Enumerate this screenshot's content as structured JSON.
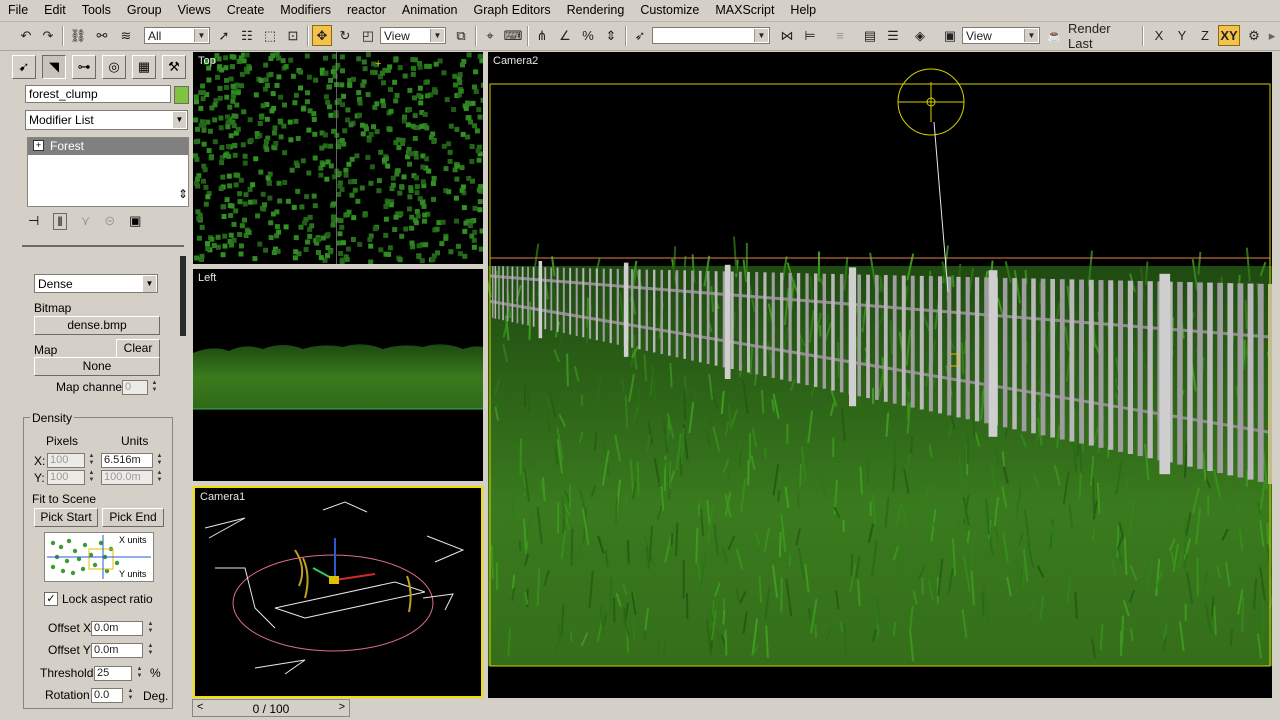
{
  "menu": [
    "File",
    "Edit",
    "Tools",
    "Group",
    "Views",
    "Create",
    "Modifiers",
    "reactor",
    "Animation",
    "Graph Editors",
    "Rendering",
    "Customize",
    "MAXScript",
    "Help"
  ],
  "toolbar": {
    "selection_filter": "All",
    "ref_coord_1": "View",
    "ref_coord_2": "View",
    "named_selection": "",
    "render_last_label": "Render Last",
    "axis_x": "X",
    "axis_y": "Y",
    "axis_z": "Z",
    "axis_xy": "XY"
  },
  "command_panel": {
    "object_name": "forest_clump",
    "object_color": "#7ec440",
    "modifier_list": "Modifier List",
    "stack_item": "Forest",
    "distribution_mode": "Dense",
    "bitmap_label": "Bitmap",
    "bitmap_button": "dense.bmp",
    "map_label": "Map",
    "clear_button": "Clear",
    "map_button": "None",
    "map_channel_label": "Map channel",
    "map_channel_value": "0",
    "density_group": "Density",
    "pixels_header": "Pixels",
    "units_header": "Units",
    "x_label": "X:",
    "y_label": "Y:",
    "x_pixels": "100",
    "x_units": "6.516m",
    "y_pixels": "100",
    "y_units": "100.0m",
    "fit_to_scene": "Fit to Scene",
    "pick_start": "Pick Start",
    "pick_end": "Pick End",
    "x_units_caption": "X units",
    "y_units_caption": "Y units",
    "lock_aspect_label": "Lock aspect ratio",
    "lock_aspect_checked": true,
    "offset_x_label": "Offset X",
    "offset_x_value": "0.0m",
    "offset_y_label": "Offset Y",
    "offset_y_value": "0.0m",
    "threshold_label": "Threshold",
    "threshold_value": "25",
    "threshold_unit": "%",
    "rotation_label": "Rotation",
    "rotation_value": "0.0",
    "rotation_unit": "Deg."
  },
  "viewports": {
    "top": "Top",
    "left": "Left",
    "camera1": "Camera1",
    "camera2": "Camera2",
    "active_border": "#f0e000"
  },
  "timeline": {
    "frame_display": "0 / 100"
  }
}
